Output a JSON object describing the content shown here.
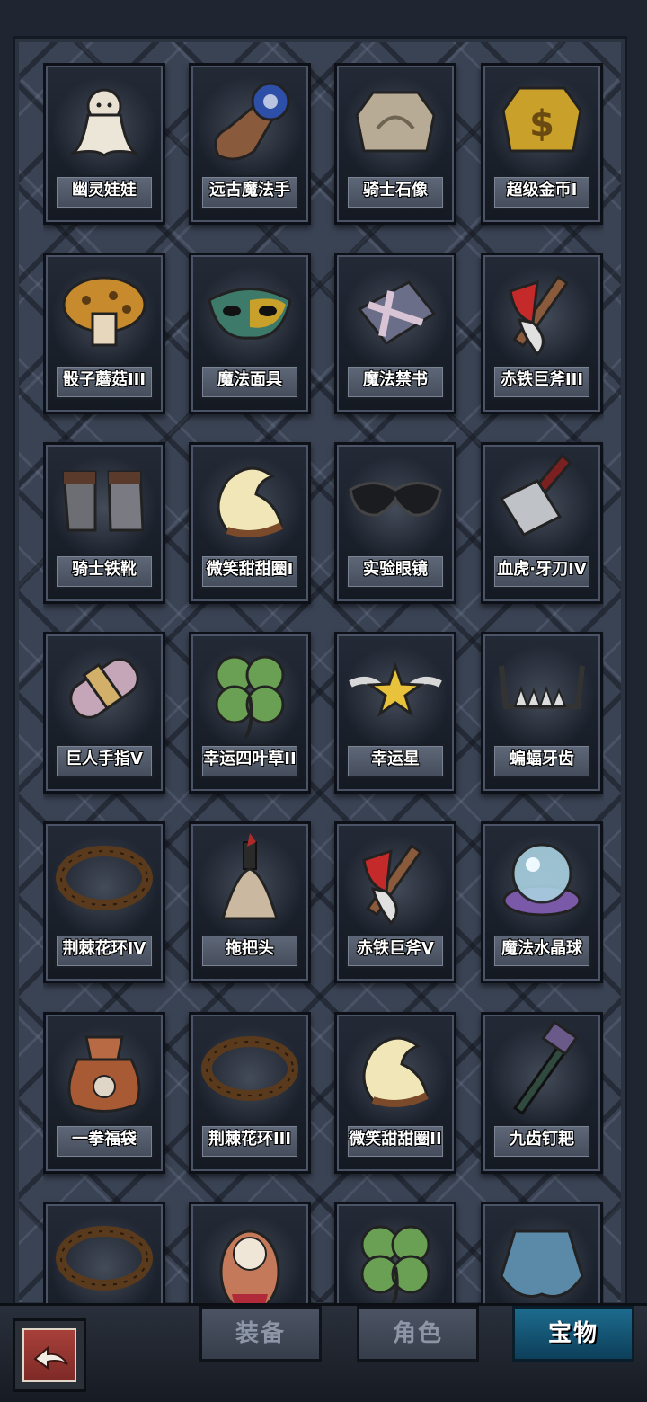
{
  "items": [
    {
      "name": "幽灵娃娃",
      "icon": "ghost-doll-icon"
    },
    {
      "name": "远古魔法手",
      "icon": "ancient-magic-hand-icon"
    },
    {
      "name": "骑士石像",
      "icon": "knight-stone-statue-icon"
    },
    {
      "name": "超级金币I",
      "icon": "super-gold-coin-icon"
    },
    {
      "name": "骰子蘑菇III",
      "icon": "dice-mushroom-icon"
    },
    {
      "name": "魔法面具",
      "icon": "magic-mask-icon"
    },
    {
      "name": "魔法禁书",
      "icon": "forbidden-magic-book-icon"
    },
    {
      "name": "赤铁巨斧III",
      "icon": "red-iron-axe-icon"
    },
    {
      "name": "骑士铁靴",
      "icon": "knight-iron-boots-icon"
    },
    {
      "name": "微笑甜甜圈I",
      "icon": "smile-donut-icon"
    },
    {
      "name": "实验眼镜",
      "icon": "lab-goggles-icon"
    },
    {
      "name": "血虎·牙刀IV",
      "icon": "blood-tiger-cleaver-icon"
    },
    {
      "name": "巨人手指V",
      "icon": "giant-finger-icon"
    },
    {
      "name": "幸运四叶草II",
      "icon": "four-leaf-clover-icon"
    },
    {
      "name": "幸运星",
      "icon": "lucky-star-icon"
    },
    {
      "name": "蝙蝠牙齿",
      "icon": "bat-teeth-icon"
    },
    {
      "name": "荆棘花环IV",
      "icon": "thorn-wreath-icon"
    },
    {
      "name": "拖把头",
      "icon": "mop-head-icon"
    },
    {
      "name": "赤铁巨斧V",
      "icon": "red-iron-axe-icon"
    },
    {
      "name": "魔法水晶球",
      "icon": "crystal-ball-icon"
    },
    {
      "name": "一拳福袋",
      "icon": "fist-lucky-bag-icon"
    },
    {
      "name": "荆棘花环III",
      "icon": "thorn-wreath-icon"
    },
    {
      "name": "微笑甜甜圈II",
      "icon": "smile-donut-icon"
    },
    {
      "name": "九齿钉耙",
      "icon": "nine-tooth-rake-icon"
    },
    {
      "name": "",
      "icon": "thorn-wreath-icon"
    },
    {
      "name": "",
      "icon": "nesting-doll-icon"
    },
    {
      "name": "",
      "icon": "four-leaf-clover-icon"
    },
    {
      "name": "",
      "icon": "shoulder-armor-icon"
    }
  ],
  "tabs": [
    {
      "label": "装备",
      "active": false
    },
    {
      "label": "角色",
      "active": false
    },
    {
      "label": "宝物",
      "active": true
    }
  ],
  "back_button": {
    "icon": "back-arrow-icon"
  }
}
